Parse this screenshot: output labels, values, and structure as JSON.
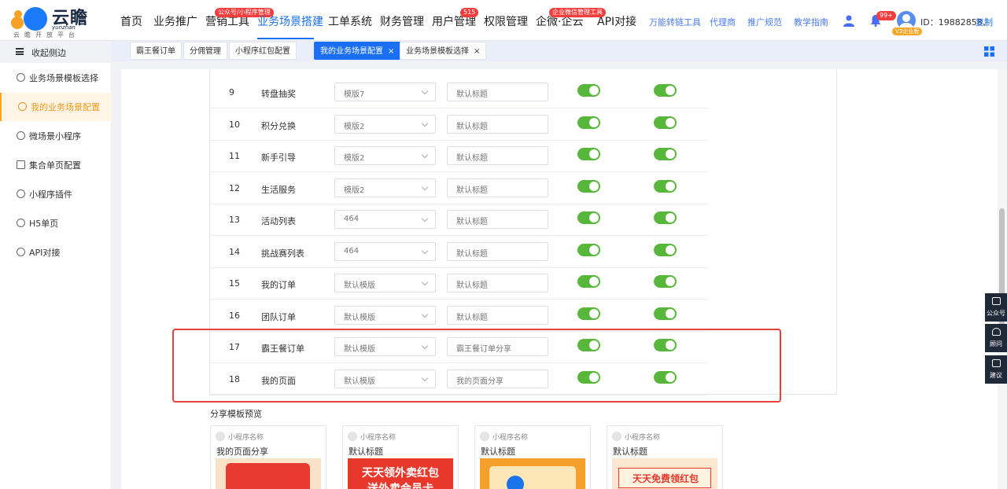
{
  "logo": {
    "brand": "云瞻",
    "latin": "yunzhan",
    "slogan": "云瞻开放平台"
  },
  "nav": {
    "items": [
      "首页",
      "业务推广",
      "营销工具",
      "业务场景搭建",
      "工单系统",
      "财务管理",
      "用户管理",
      "权限管理",
      "企微·企云",
      "API对接"
    ],
    "badges": {
      "marketing": "公众号/小程序管理",
      "users": "515",
      "wecom": "企业微信管理工具"
    },
    "links": [
      "万能转链工具",
      "代理商",
      "推广规范",
      "教学指南"
    ],
    "notif_count": "99+",
    "vip": "V3企业版",
    "user_id": "ID：19882858、",
    "copy": "复制"
  },
  "sidebar": {
    "collapse": "收起侧边",
    "items": [
      "业务场景模板选择",
      "我的业务场景配置",
      "微场景小程序",
      "集合单页配置",
      "小程序插件",
      "H5单页",
      "API对接"
    ]
  },
  "tabs": [
    "霸王餐订单",
    "分佣管理",
    "小程序红包配置",
    "我的业务场景配置",
    "业务场景模板选择"
  ],
  "table": {
    "rows": [
      {
        "no": "9",
        "name": "转盘抽奖",
        "template": "模版7",
        "title": "默认标题"
      },
      {
        "no": "10",
        "name": "积分兑换",
        "template": "模版2",
        "title": "默认标题"
      },
      {
        "no": "11",
        "name": "新手引导",
        "template": "模版2",
        "title": "默认标题"
      },
      {
        "no": "12",
        "name": "生活服务",
        "template": "模版2",
        "title": "默认标题"
      },
      {
        "no": "13",
        "name": "活动列表",
        "template": "464",
        "title": "默认标题"
      },
      {
        "no": "14",
        "name": "挑战赛列表",
        "template": "464",
        "title": "默认标题"
      },
      {
        "no": "15",
        "name": "我的订单",
        "template": "默认模版",
        "title": "默认标题"
      },
      {
        "no": "16",
        "name": "团队订单",
        "template": "默认模版",
        "title": "默认标题"
      },
      {
        "no": "17",
        "name": "霸王餐订单",
        "template": "默认模版",
        "title": "霸王餐订单分享"
      },
      {
        "no": "18",
        "name": "我的页面",
        "template": "默认模版",
        "title": "我的页面分享"
      }
    ]
  },
  "preview": {
    "title": "分享模板预览",
    "cards": [
      {
        "name": "小程序名称",
        "title": "我的页面分享",
        "img_text": [
          "",
          ""
        ]
      },
      {
        "name": "小程序名称",
        "title": "默认标题",
        "img_text": [
          "天天领外卖红包",
          "送外卖会员卡"
        ]
      },
      {
        "name": "小程序名称",
        "title": "默认标题",
        "img_text": [
          "",
          ""
        ]
      },
      {
        "name": "小程序名称",
        "title": "默认标题",
        "img_text": [
          "天天免费领红包",
          ""
        ]
      }
    ]
  },
  "float_bar": [
    "公众号",
    "顾问",
    "建议"
  ],
  "colors": {
    "primary": "#1a6ff5",
    "accent": "#f7a226",
    "switch_on": "#57b73b",
    "highlight": "#e4423a"
  }
}
